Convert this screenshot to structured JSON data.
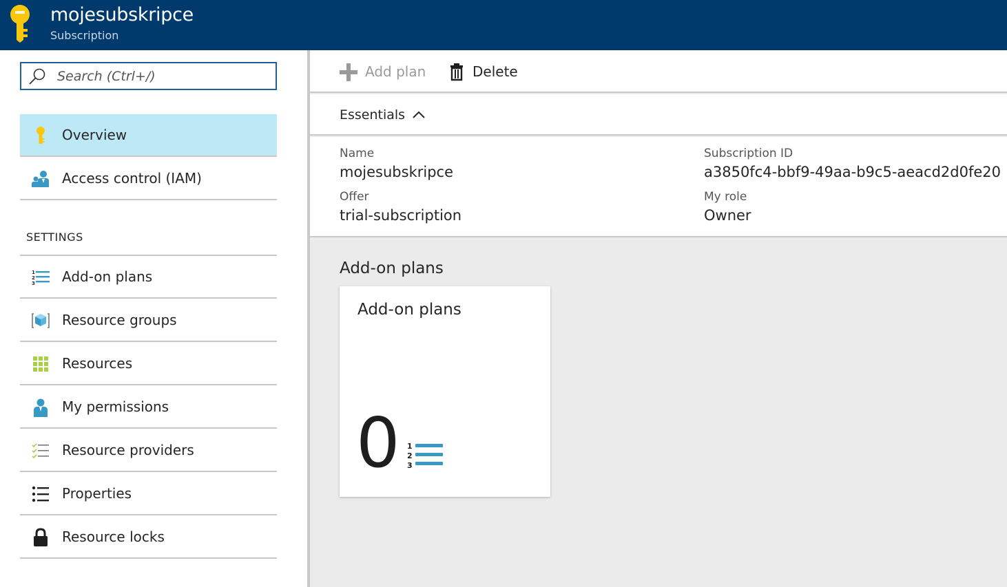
{
  "header": {
    "title": "mojesubskripce",
    "subtitle": "Subscription",
    "icon": "key-icon",
    "background": "#003a6c"
  },
  "sidebar": {
    "search_placeholder": "Search (Ctrl+/)",
    "items_top": [
      {
        "label": "Overview",
        "icon": "key-icon",
        "active": true
      },
      {
        "label": "Access control (IAM)",
        "icon": "users-icon"
      }
    ],
    "settings_label": "SETTINGS",
    "items_settings": [
      {
        "label": "Add-on plans",
        "icon": "numbered-list-icon"
      },
      {
        "label": "Resource groups",
        "icon": "cube-icon"
      },
      {
        "label": "Resources",
        "icon": "grid-icon"
      },
      {
        "label": "My permissions",
        "icon": "user-icon"
      },
      {
        "label": "Resource providers",
        "icon": "checklist-icon"
      },
      {
        "label": "Properties",
        "icon": "bullet-list-icon"
      },
      {
        "label": "Resource locks",
        "icon": "lock-icon"
      }
    ]
  },
  "toolbar": {
    "add_plan_label": "Add plan",
    "delete_label": "Delete"
  },
  "essentials": {
    "label": "Essentials",
    "name_key": "Name",
    "name_value": "mojesubskripce",
    "offer_key": "Offer",
    "offer_value": "trial-subscription",
    "subscription_id_key": "Subscription ID",
    "subscription_id_value": "a3850fc4-bbf9-49aa-b9c5-aeacd2d0fe20",
    "role_key": "My role",
    "role_value": "Owner"
  },
  "addon": {
    "section_title": "Add-on plans",
    "tile_title": "Add-on plans",
    "count": "0"
  },
  "colors": {
    "accent": "#0072c6",
    "active_bg": "#bde9f6",
    "key_yellow": "#f9c80e",
    "icon_blue": "#3999c6"
  }
}
